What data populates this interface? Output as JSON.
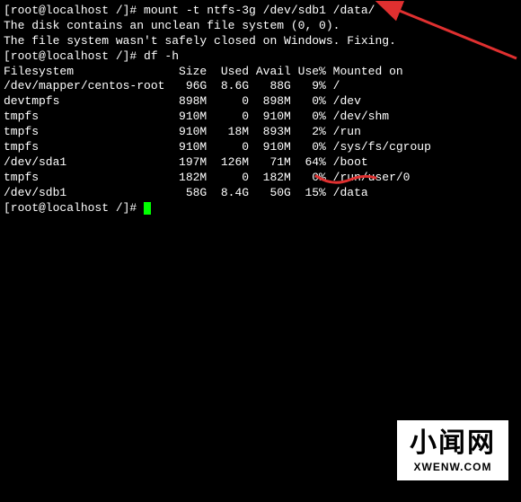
{
  "prompt1": "[root@localhost /]# ",
  "cmd1": "mount -t ntfs-3g /dev/sdb1 /data/",
  "msg1": "The disk contains an unclean file system (0, 0).",
  "msg2": "The file system wasn't safely closed on Windows. Fixing.",
  "prompt2": "[root@localhost /]# ",
  "cmd2": "df -h",
  "df_header": "Filesystem               Size  Used Avail Use% Mounted on",
  "df_rows": [
    "/dev/mapper/centos-root   96G  8.6G   88G   9% /",
    "devtmpfs                 898M     0  898M   0% /dev",
    "tmpfs                    910M     0  910M   0% /dev/shm",
    "tmpfs                    910M   18M  893M   2% /run",
    "tmpfs                    910M     0  910M   0% /sys/fs/cgroup",
    "/dev/sda1                197M  126M   71M  64% /boot",
    "tmpfs                    182M     0  182M   0% /run/user/0",
    "/dev/sdb1                 58G  8.4G   50G  15% /data"
  ],
  "prompt3": "[root@localhost /]# ",
  "watermark": {
    "main": "小闻网",
    "sub": "XWENW.COM"
  },
  "annotation_color": "#e03030"
}
